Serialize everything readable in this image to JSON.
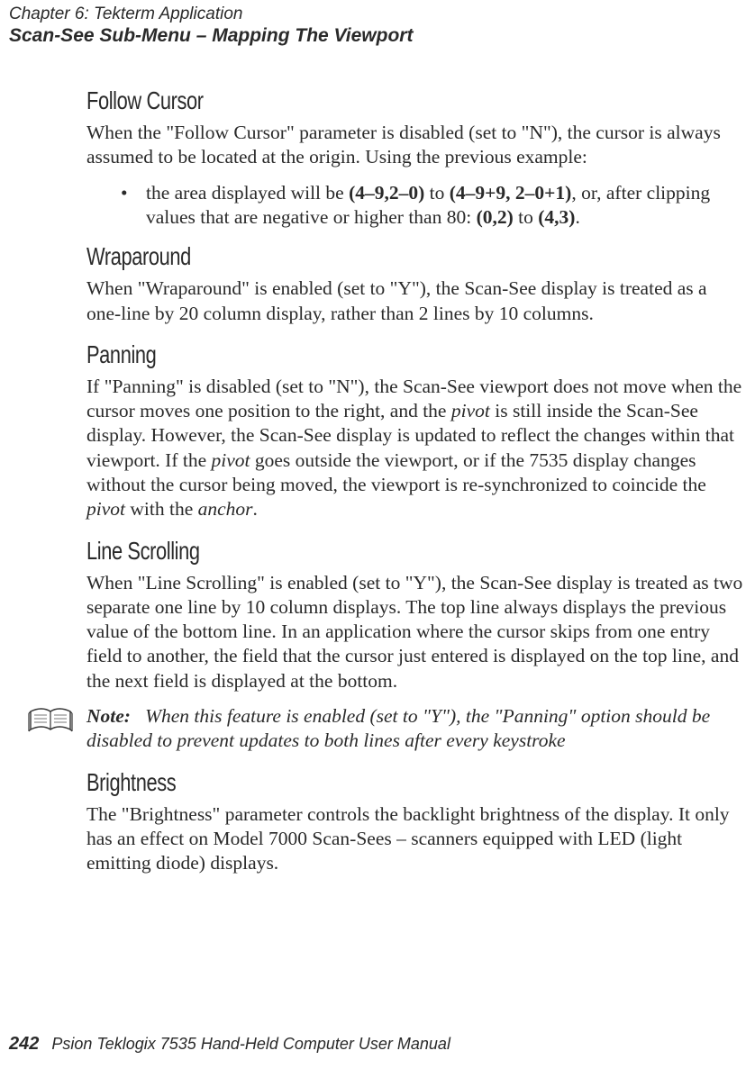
{
  "header": {
    "chapter": "Chapter 6: Tekterm Application",
    "sub": "Scan-See Sub-Menu – Mapping The Viewport"
  },
  "sections": {
    "follow_cursor": {
      "heading": "Follow Cursor",
      "p1": "When the \"Follow Cursor\" parameter is disabled (set to \"N\"), the cursor is always assumed to be located at the origin. Using the previous example:",
      "bullet_pre": "the area displayed will be ",
      "bullet_b1": "(4–9,2–0)",
      "bullet_mid1": " to ",
      "bullet_b2": "(4–9+9, 2–0+1)",
      "bullet_mid2": ", or, after clipping values that are negative or higher than 80:    ",
      "bullet_b3": "(0,2)",
      "bullet_mid3": " to ",
      "bullet_b4": "(4,3)",
      "bullet_end": "."
    },
    "wraparound": {
      "heading": "Wraparound",
      "p1": "When \"Wraparound\" is enabled (set to \"Y\"), the Scan-See display is treated as a one-line by 20 column display, rather than 2 lines by 10 columns."
    },
    "panning": {
      "heading": "Panning",
      "p1_a": "If \"Panning\" is disabled (set to \"N\"), the Scan-See viewport does not move when the cursor moves one position to the right, and the  ",
      "p1_i1": "pivot",
      "p1_b": "  is still inside the Scan-See display. However, the Scan-See display is updated to reflect the changes within that viewport. If the  ",
      "p1_i2": "pivot",
      "p1_c": "  goes outside the viewport, or if the 7535 display changes without the cursor being moved, the viewport is re-synchronized to coincide the  ",
      "p1_i3": "pivot",
      "p1_d": "  with the  ",
      "p1_i4": "anchor",
      "p1_e": "."
    },
    "line_scrolling": {
      "heading": "Line Scrolling",
      "p1": "When \"Line Scrolling\" is enabled (set to \"Y\"), the Scan-See display is treated as two separate one line by 10 column displays. The top line always displays the previous value of the bottom line. In an application where the cursor skips from one entry field to another, the field that the cursor just entered is displayed on the top line, and the next field is displayed at the bottom."
    },
    "note": {
      "label": "Note:",
      "text": "When this feature is enabled (set to \"Y\"), the \"Panning\" option should be disabled to prevent updates to both lines after every keystroke"
    },
    "brightness": {
      "heading": "Brightness",
      "p1": "The \"Brightness\" parameter controls the backlight brightness of the display. It only has an effect on Model 7000 Scan-Sees – scanners equipped with LED (light emitting diode) displays."
    }
  },
  "footer": {
    "page_number": "242",
    "title": "Psion Teklogix 7535 Hand-Held Computer User Manual"
  }
}
